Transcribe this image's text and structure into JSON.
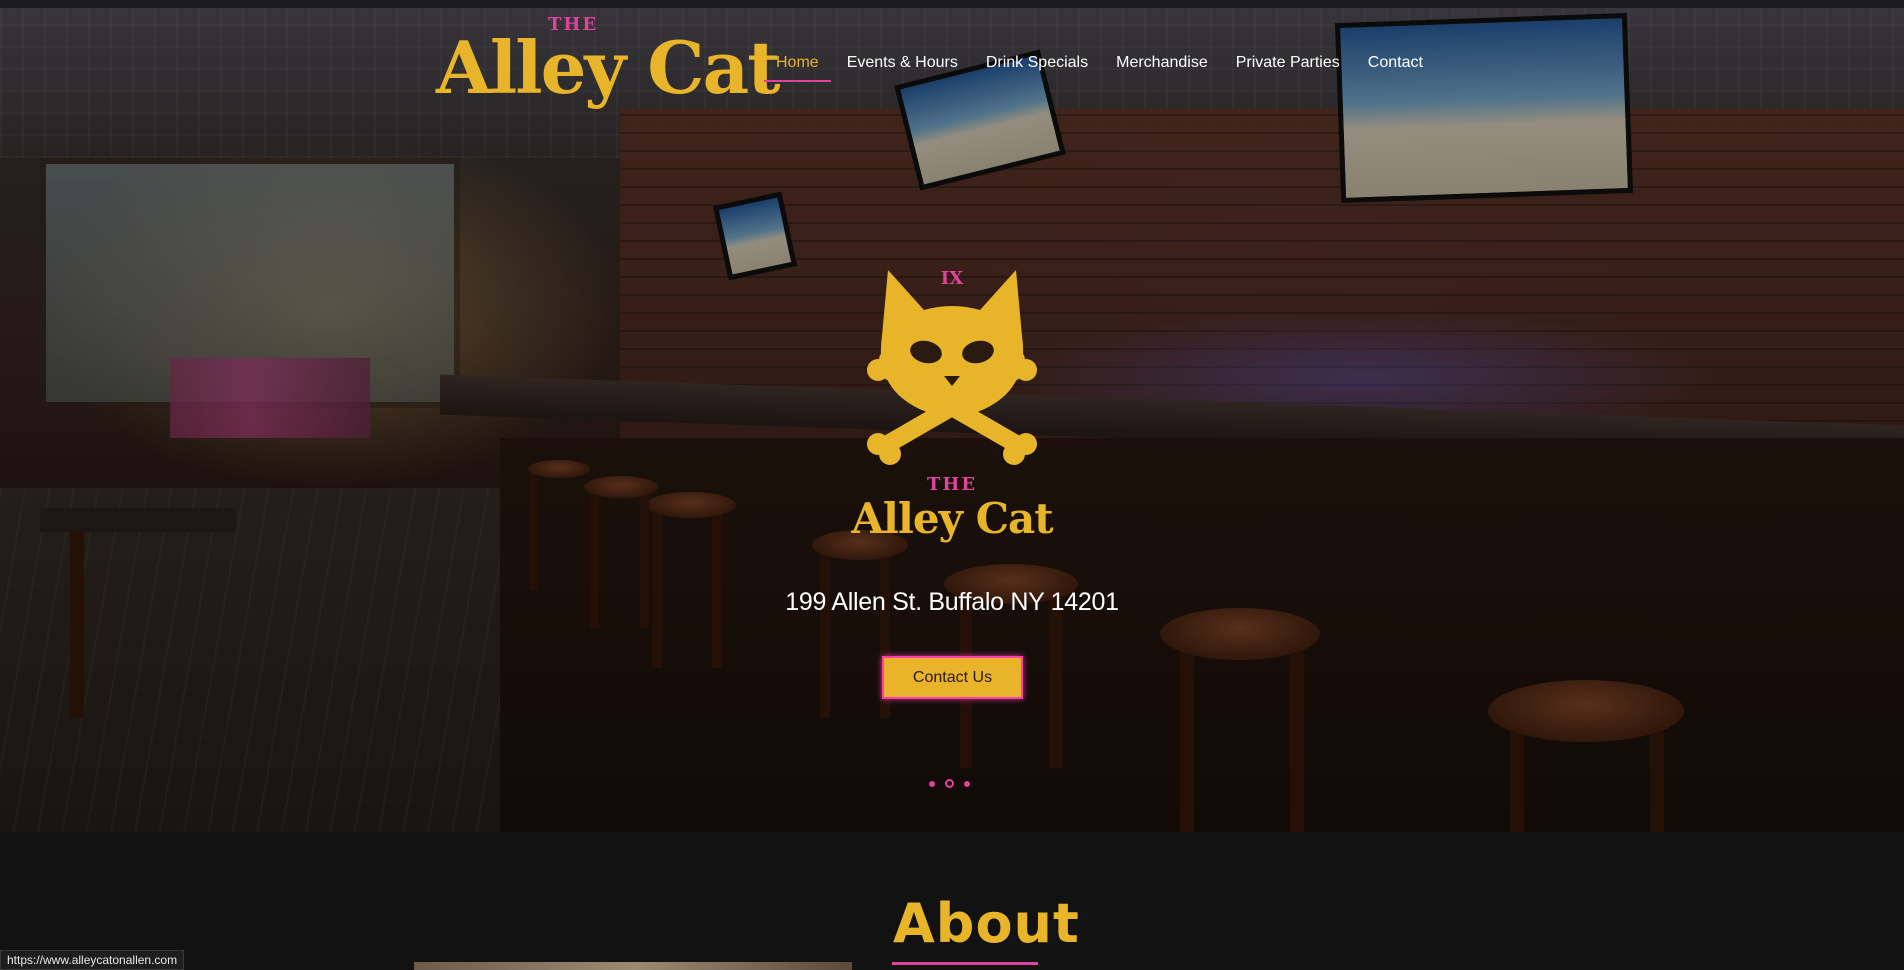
{
  "header": {
    "logo_the": "THE",
    "logo_name": "Alley Cat",
    "nav": [
      {
        "label": "Home",
        "active": true
      },
      {
        "label": "Events & Hours",
        "active": false
      },
      {
        "label": "Drink Specials",
        "active": false
      },
      {
        "label": "Merchandise",
        "active": false
      },
      {
        "label": "Private Parties",
        "active": false
      },
      {
        "label": "Contact",
        "active": false
      }
    ]
  },
  "hero": {
    "emblem_numeral": "IX",
    "emblem_the": "THE",
    "emblem_name": "Alley Cat",
    "address": "199 Allen St. Buffalo NY 14201",
    "cta_label": "Contact Us",
    "slides": 3,
    "active_slide": 2
  },
  "about": {
    "title": "About"
  },
  "status_bar": {
    "url": "https://www.alleycatonallen.com"
  },
  "colors": {
    "brand_gold": "#e8b42a",
    "brand_pink": "#e0439d",
    "background": "#121212"
  }
}
